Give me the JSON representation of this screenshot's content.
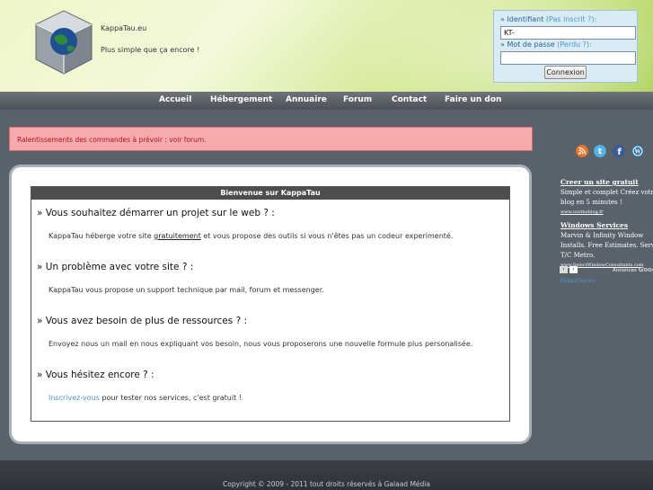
{
  "header": {
    "site_name": "KappaTau.eu",
    "slogan": "Plus simple que ça encore !"
  },
  "login": {
    "identifiant_label": "» Identifiant",
    "identifiant_alt": "(Pas inscrit ?):",
    "identifiant_value": "KT-",
    "password_label": "» Mot de passe",
    "password_alt": "(Perdu ?):",
    "password_value": "",
    "submit_label": "Connexion"
  },
  "nav": {
    "items": [
      "Accueil",
      "Hébergement",
      "Annuaire",
      "Forum",
      "Contact",
      "Faire un don"
    ]
  },
  "notice": "Ralentissements des commandes à prévoir : voir forum.",
  "social_icons": [
    "rss-icon",
    "twitter-icon",
    "facebook-icon",
    "wordpress-icon"
  ],
  "main": {
    "panel_title": "Bienvenue sur KappaTau",
    "sections": [
      {
        "title": "» Vous souhaitez démarrer un projet sur le web ? :",
        "text_before": "KappaTau héberge votre site ",
        "link": "gratuitement",
        "text_after": " et vous propose des outils si vous n'êtes pas un codeur experimenté."
      },
      {
        "title": "» Un problème avec votre site ? :",
        "text": "KappaTau vous propose un support technique par mail, forum et messenger."
      },
      {
        "title": "» Vous avez besoin de plus de ressources ? :",
        "text": "Envoyez nous un mail en nous expliquant vos besoin, nous vous proposerons une nouvelle formule plus personalisée."
      },
      {
        "title": "» Vous hésitez encore ? :",
        "link": "Inscrivez-vous",
        "text_after": " pour tester nos services, c'est gratuit !"
      }
    ]
  },
  "ads": {
    "ad1_title": "Creer un site gratuit",
    "ad1_line1": "Simple et complet Créez votre",
    "ad1_line2": "blog en 5 minutes !",
    "ad1_url": "www.ouvmoblog.fr",
    "ad2_title": "Windows Services",
    "ad2_line1": "Marvin & Infinity Window",
    "ad2_line2": "Installs. Free Estimates. Serving",
    "ad2_line3": "T/C Metro.",
    "ad2_url": "www.SelectWindowConsultants.com",
    "annonces_label": "Annonces",
    "annonces_brand": "Goog",
    "extra_link": "KappaTau.eu"
  },
  "footer": {
    "copyright": "Copyright © 2009 - 2011 tout droits réservés à Galaad Média"
  },
  "colors": {
    "header_green": "#cfe68a",
    "nav_gray": "#5a5f66",
    "notice_pink": "#f6aaae",
    "notice_text": "#b0151f",
    "link_blue": "#4a97c9",
    "panel_head": "#4d4d4d"
  }
}
